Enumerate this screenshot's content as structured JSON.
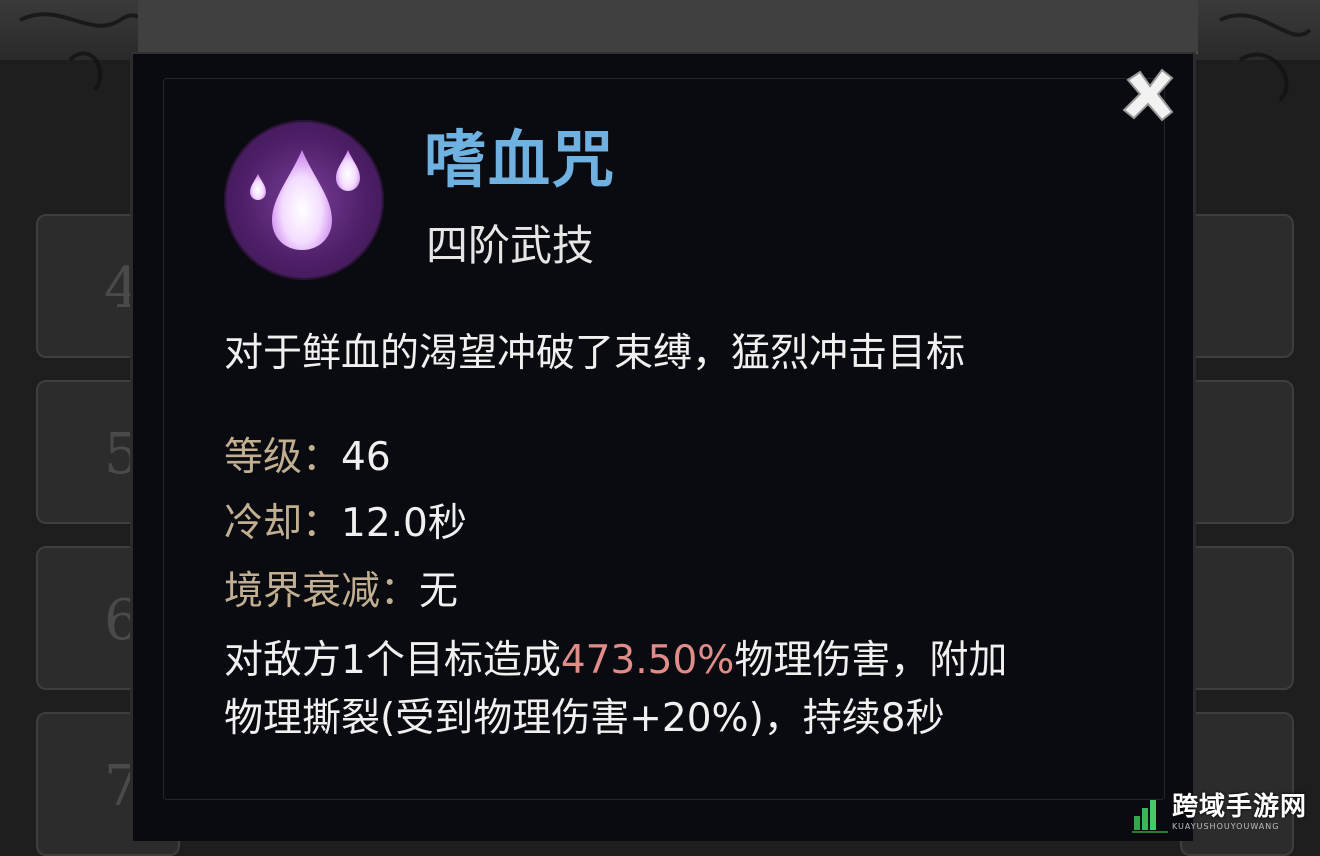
{
  "background": {
    "slot_numbers": [
      "4",
      "5",
      "6",
      "7"
    ]
  },
  "skill": {
    "name": "嗜血咒",
    "tier": "四阶武技",
    "description": "对于鲜血的渴望冲破了束缚，猛烈冲击目标",
    "icon": "blood-drops-icon"
  },
  "stats": [
    {
      "label": "等级：",
      "value": "46"
    },
    {
      "label": "冷却：",
      "value": "12.0秒"
    },
    {
      "label": "境界衰减：",
      "value": "无"
    }
  ],
  "effect": {
    "line1_before": "对敌方1个目标造成",
    "line1_highlight": "473.50%",
    "line1_after": "物理伤害，附加",
    "line2": "物理撕裂(受到物理伤害+20%)，持续8秒"
  },
  "close": {
    "icon": "close-icon"
  },
  "watermark": {
    "text": "跨域手游网",
    "sub": "KUAYUSHOUYOUWANG"
  },
  "colors": {
    "skill_name": "#6fb2e2",
    "stat_label": "#c2ae90",
    "highlight": "#e08c88",
    "icon_purple": "#4e1f68"
  }
}
